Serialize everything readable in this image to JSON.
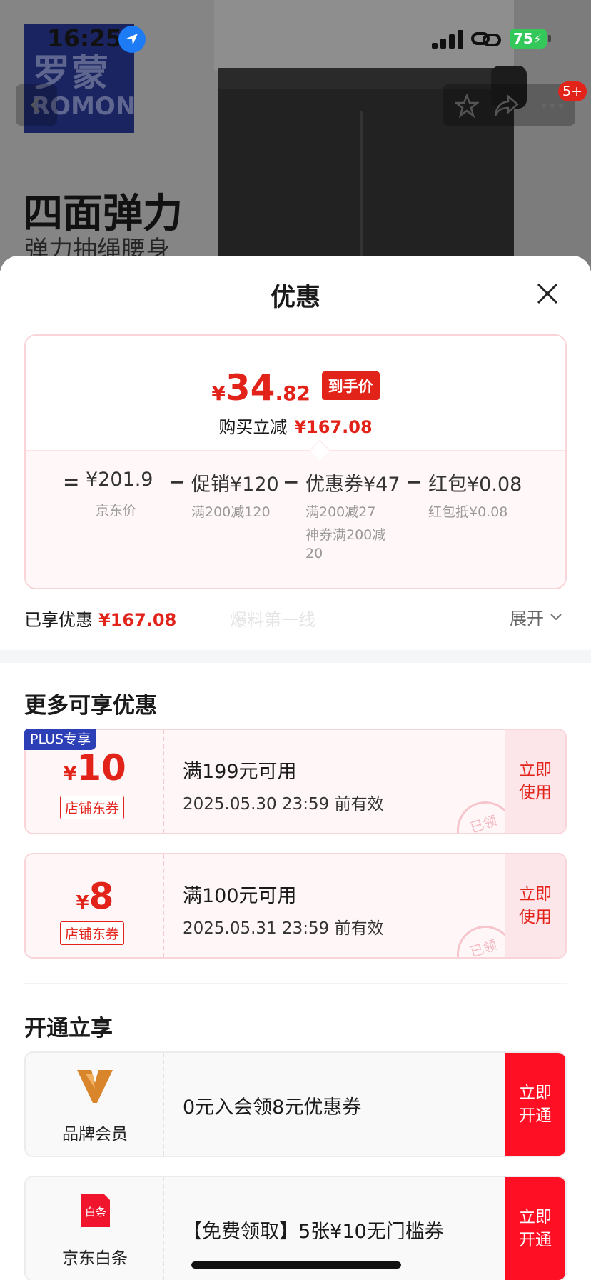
{
  "status_bar": {
    "time": "16:25",
    "battery": "75"
  },
  "background": {
    "logo_cn": "罗蒙",
    "logo_en": "ROMON",
    "ad_title": "四面弹力",
    "ad_subtitle": "弹力抽绳腰身",
    "cart_badge": "5+"
  },
  "sheet": {
    "title": "优惠",
    "final_price": {
      "currency": "¥",
      "integer": "34",
      "decimal": ".82",
      "tag": "到手价"
    },
    "reduce": {
      "label": "购买立减",
      "amount": "¥167.08"
    },
    "breakdown": {
      "eq": "=",
      "minus": "−",
      "items": [
        {
          "value": "¥201.9",
          "subs": [
            "京东价"
          ]
        },
        {
          "value": "促销¥120",
          "subs": [
            "满200减120"
          ]
        },
        {
          "value": "优惠券¥47",
          "subs": [
            "满200减27",
            "神券满200减",
            "20"
          ]
        },
        {
          "value": "红包¥0.08",
          "subs": [
            "红包抵¥0.08"
          ]
        }
      ]
    },
    "enjoyed": {
      "label": "已享优惠",
      "amount": "¥167.08"
    },
    "watermark": "爆料第一线",
    "expand_label": "展开",
    "more_section_title": "更多可享优惠",
    "coupons": [
      {
        "badge": "PLUS专享",
        "currency": "¥",
        "amount": "10",
        "kind": "店铺东券",
        "condition": "满199元可用",
        "expiry": "2025.05.30 23:59 前有效",
        "action": "立即使用",
        "stamp": "已领"
      },
      {
        "badge": "",
        "currency": "¥",
        "amount": "8",
        "kind": "店铺东券",
        "condition": "满100元可用",
        "expiry": "2025.05.31 23:59 前有效",
        "action": "立即使用",
        "stamp": "已领"
      }
    ],
    "open_section_title": "开通立享",
    "memberships": [
      {
        "name": "品牌会员",
        "icon": "brand-v-icon",
        "desc": "0元入会领8元优惠券",
        "action": "立即开通"
      },
      {
        "name": "京东白条",
        "icon": "baitiao-icon",
        "icon_text": "白条",
        "desc": "【免费领取】5张¥10无门槛券",
        "action": "立即开通"
      }
    ]
  },
  "colors": {
    "accent_red": "#e2231a",
    "plus_blue": "#2d3fb6",
    "open_red": "#ff0f23",
    "battery_green": "#34c759"
  }
}
